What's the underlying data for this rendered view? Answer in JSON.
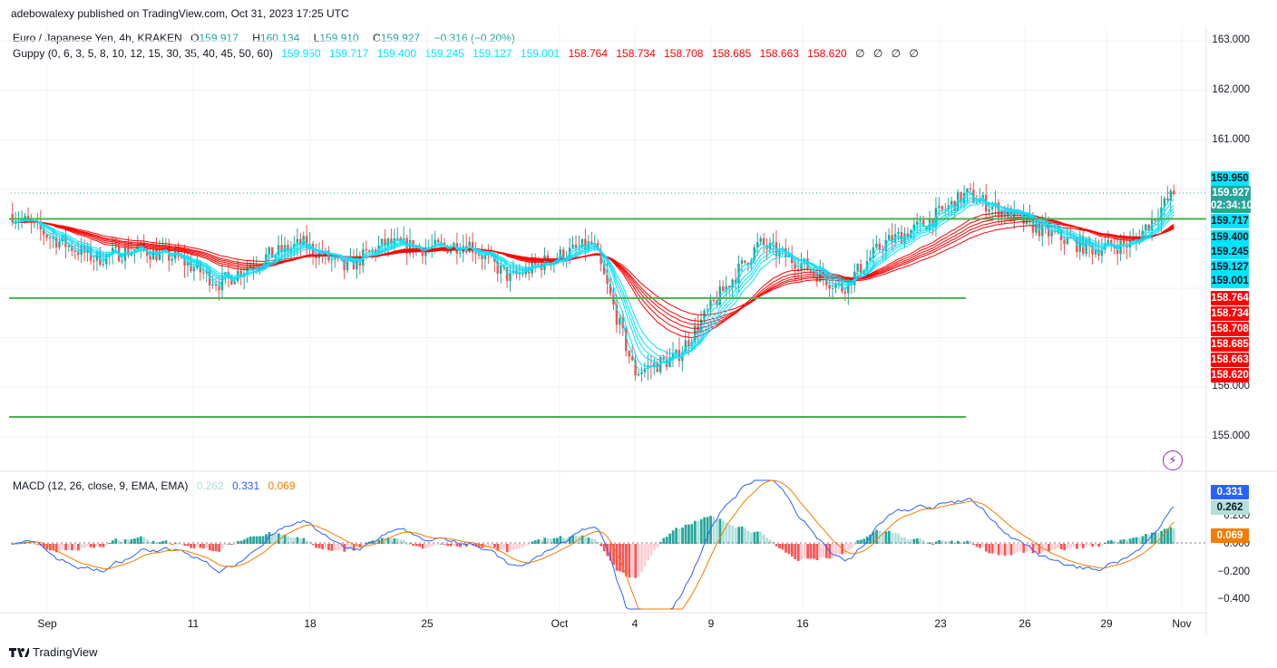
{
  "header": {
    "publisher_line": "adebowalexy published on TradingView.com, Oct 31, 2023 17:25 UTC"
  },
  "symbol_legend": {
    "title": "Euro / Japanese Yen, 4h, KRAKEN",
    "open_label": "O",
    "open": "159.917",
    "high_label": "H",
    "high": "160.134",
    "low_label": "L",
    "low": "159.910",
    "close_label": "C",
    "close": "159.927",
    "change": "−0.316 (−0.20%)"
  },
  "guppy_legend": {
    "title": "Guppy (0, 6, 3, 5, 8, 10, 12, 15, 30, 35, 40, 45, 50, 60)",
    "short_values": [
      "159.950",
      "159.717",
      "159.400",
      "159.245",
      "159.127",
      "159.001"
    ],
    "long_values": [
      "158.764",
      "158.734",
      "158.708",
      "158.685",
      "158.663",
      "158.620"
    ],
    "empty_values": [
      "∅",
      "∅",
      "∅",
      "∅"
    ]
  },
  "macd_legend": {
    "title": "MACD (12, 26, close, 9, EMA, EMA)",
    "values": [
      "0.262",
      "0.331",
      "0.069"
    ]
  },
  "price_axis": {
    "ticks": [
      "163.000",
      "162.000",
      "161.000",
      "156.000",
      "155.000"
    ],
    "tags": [
      {
        "text": "159.950",
        "bg": "#00e5ff",
        "fg": "#131722"
      },
      {
        "text": "159.927",
        "bg": "#26a69a",
        "fg": "#ffffff"
      },
      {
        "text": "02:34:10",
        "bg": "#26a69a",
        "fg": "#ffffff"
      },
      {
        "text": "159.717",
        "bg": "#00e5ff",
        "fg": "#131722"
      },
      {
        "text": "159.400",
        "bg": "#00e5ff",
        "fg": "#131722"
      },
      {
        "text": "159.245",
        "bg": "#00e5ff",
        "fg": "#131722"
      },
      {
        "text": "159.127",
        "bg": "#00e5ff",
        "fg": "#131722"
      },
      {
        "text": "159.001",
        "bg": "#00e5ff",
        "fg": "#131722"
      },
      {
        "text": "158.764",
        "bg": "#ff0000",
        "fg": "#ffffff"
      },
      {
        "text": "158.734",
        "bg": "#ff0000",
        "fg": "#ffffff"
      },
      {
        "text": "158.708",
        "bg": "#ff0000",
        "fg": "#ffffff"
      },
      {
        "text": "158.685",
        "bg": "#ff0000",
        "fg": "#ffffff"
      },
      {
        "text": "158.663",
        "bg": "#ff0000",
        "fg": "#ffffff"
      },
      {
        "text": "158.620",
        "bg": "#ff0000",
        "fg": "#ffffff"
      }
    ]
  },
  "macd_axis": {
    "ticks": [
      "0.200",
      "0.000",
      "−0.200",
      "−0.400"
    ],
    "tags": [
      {
        "text": "0.331",
        "bg": "#2962ff",
        "fg": "#ffffff"
      },
      {
        "text": "0.262",
        "bg": "#b2dfdb",
        "fg": "#131722"
      },
      {
        "text": "0.069",
        "bg": "#f57c00",
        "fg": "#ffffff"
      }
    ]
  },
  "time_axis": [
    "Sep",
    "11",
    "18",
    "25",
    "Oct",
    "4",
    "9",
    "16",
    "23",
    "26",
    "29",
    "Nov"
  ],
  "footer": {
    "brand": "TradingView"
  },
  "colors": {
    "up": "#26a69a",
    "down": "#ef5350",
    "short_ema": "#00e5ff",
    "long_ema": "#ff0000",
    "support_lines": "#4caf50",
    "macd_line": "#2962ff",
    "signal_line": "#f57c00",
    "hist_up_strong": "#26a69a",
    "hist_up_weak": "#b2dfdb",
    "hist_down_strong": "#ff5252",
    "hist_down_weak": "#ffcdd2"
  },
  "chart_data": [
    {
      "type": "candlestick",
      "title": "Euro / Japanese Yen, 4h, KRAKEN",
      "x_range": [
        "Aug 30, 2023",
        "Oct 31, 2023"
      ],
      "ylim": [
        154.6,
        163.4
      ],
      "horizontal_lines": [
        159.4,
        157.8,
        155.4
      ],
      "guppy_short_last": [
        159.95,
        159.717,
        159.4,
        159.245,
        159.127,
        159.001
      ],
      "guppy_long_last": [
        158.764,
        158.734,
        158.708,
        158.685,
        158.663,
        158.62
      ],
      "close_path": [
        {
          "x": "Aug 30",
          "y": 159.5
        },
        {
          "x": "Sep 1",
          "y": 159.0
        },
        {
          "x": "Sep 4",
          "y": 158.6
        },
        {
          "x": "Sep 6",
          "y": 158.8
        },
        {
          "x": "Sep 8",
          "y": 158.6
        },
        {
          "x": "Sep 11",
          "y": 158.1
        },
        {
          "x": "Sep 13",
          "y": 158.6
        },
        {
          "x": "Sep 15",
          "y": 158.9
        },
        {
          "x": "Sep 18",
          "y": 158.4
        },
        {
          "x": "Sep 20",
          "y": 158.9
        },
        {
          "x": "Sep 22",
          "y": 158.8
        },
        {
          "x": "Sep 25",
          "y": 158.9
        },
        {
          "x": "Sep 27",
          "y": 158.2
        },
        {
          "x": "Sep 29",
          "y": 158.6
        },
        {
          "x": "Oct 2",
          "y": 158.9
        },
        {
          "x": "Oct 3",
          "y": 156.3
        },
        {
          "x": "Oct 5",
          "y": 156.6
        },
        {
          "x": "Oct 9",
          "y": 157.8
        },
        {
          "x": "Oct 11",
          "y": 158.9
        },
        {
          "x": "Oct 13",
          "y": 158.5
        },
        {
          "x": "Oct 16",
          "y": 158.0
        },
        {
          "x": "Oct 18",
          "y": 158.9
        },
        {
          "x": "Oct 20",
          "y": 159.3
        },
        {
          "x": "Oct 23",
          "y": 159.9
        },
        {
          "x": "Oct 24",
          "y": 159.5
        },
        {
          "x": "Oct 26",
          "y": 159.1
        },
        {
          "x": "Oct 27",
          "y": 158.8
        },
        {
          "x": "Oct 30",
          "y": 158.9
        },
        {
          "x": "Oct 31",
          "y": 159.927
        }
      ]
    },
    {
      "type": "bar",
      "title": "MACD (12, 26, close, 9, EMA, EMA)",
      "ylim": [
        -0.45,
        0.42
      ],
      "last": {
        "histogram": 0.262,
        "macd": 0.331,
        "signal": 0.069
      },
      "histogram_sketch": [
        {
          "x": "Aug 30",
          "y": 0.15
        },
        {
          "x": "Sep 1",
          "y": -0.2
        },
        {
          "x": "Sep 4",
          "y": -0.1
        },
        {
          "x": "Sep 6",
          "y": 0.08
        },
        {
          "x": "Sep 11",
          "y": -0.06
        },
        {
          "x": "Sep 15",
          "y": 0.1
        },
        {
          "x": "Sep 20",
          "y": 0.12
        },
        {
          "x": "Sep 25",
          "y": 0.03
        },
        {
          "x": "Sep 27",
          "y": -0.12
        },
        {
          "x": "Oct 2",
          "y": 0.05
        },
        {
          "x": "Oct 4",
          "y": -0.25
        },
        {
          "x": "Oct 9",
          "y": 0.22
        },
        {
          "x": "Oct 12",
          "y": 0.15
        },
        {
          "x": "Oct 16",
          "y": -0.12
        },
        {
          "x": "Oct 20",
          "y": 0.06
        },
        {
          "x": "Oct 24",
          "y": 0.16
        },
        {
          "x": "Oct 26",
          "y": -0.15
        },
        {
          "x": "Oct 30",
          "y": -0.05
        },
        {
          "x": "Oct 31",
          "y": 0.262
        }
      ]
    }
  ]
}
